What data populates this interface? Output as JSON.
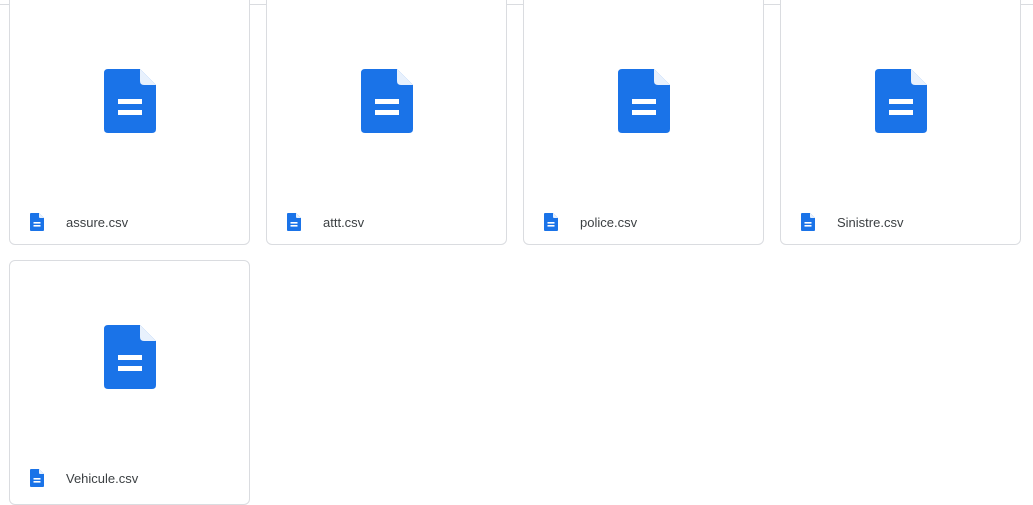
{
  "accent_color": "#1a73e8",
  "files": [
    {
      "name": "assure.csv",
      "icon": "google-docs-icon"
    },
    {
      "name": "attt.csv",
      "icon": "google-docs-icon"
    },
    {
      "name": "police.csv",
      "icon": "google-docs-icon"
    },
    {
      "name": "Sinistre.csv",
      "icon": "google-docs-icon"
    },
    {
      "name": "Vehicule.csv",
      "icon": "google-docs-icon"
    }
  ]
}
